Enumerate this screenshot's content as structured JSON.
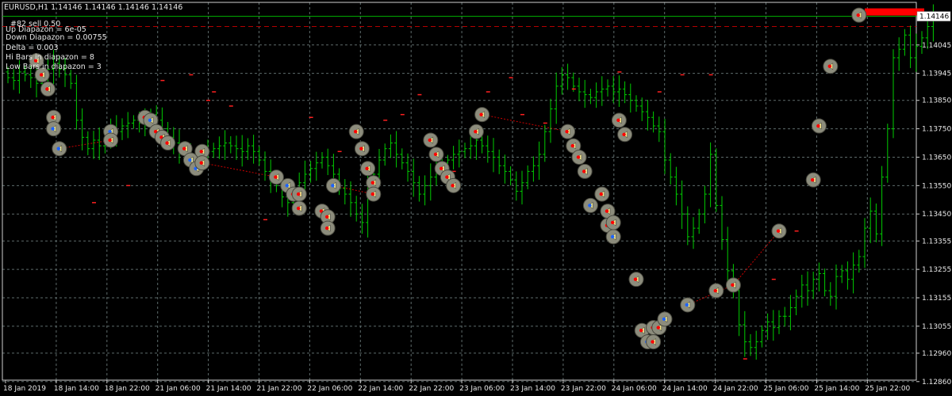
{
  "header": {
    "symbol_line": "EURUSD,H1  1.14146 1.14146 1.14146 1.14146",
    "info_lines": [
      "#82 sell 0.50",
      "Up Diapazon = 6e-05",
      "Down Diapazon = 0.00755",
      "Delta = 0.003",
      "Hi Bars in diapazon = 8",
      "Low Bars in diapazon = 3"
    ]
  },
  "colors": {
    "background": "#000000",
    "grid": "#5e6b6b",
    "bar": "#00cc00",
    "current_price_line": "#00b400",
    "order_line": "#b40000",
    "marker_up": "#ff0000",
    "marker_down": "#1e64ff",
    "marker_circle": "#8c8c7c",
    "trade_line": "#cc0000",
    "sell_box": "#ff0000"
  },
  "chart_data": {
    "type": "bar",
    "title": "",
    "xlabel": "",
    "ylabel": "",
    "symbol": "EURUSD",
    "timeframe": "H1",
    "ylim": [
      1.12865,
      1.14195
    ],
    "y_ticks": [
      "1.14045",
      "1.13945",
      "1.13850",
      "1.13750",
      "1.13650",
      "1.13550",
      "1.13450",
      "1.13355",
      "1.13255",
      "1.13155",
      "1.13055",
      "1.12960",
      "1.12860"
    ],
    "y_tick_values": [
      1.14045,
      1.13945,
      1.1385,
      1.1375,
      1.1365,
      1.1355,
      1.1345,
      1.13355,
      1.13255,
      1.13155,
      1.13055,
      1.1296,
      1.1286
    ],
    "x_ticks": [
      "18 Jan 2019",
      "18 Jan 14:00",
      "18 Jan 22:00",
      "21 Jan 06:00",
      "21 Jan 14:00",
      "21 Jan 22:00",
      "22 Jan 06:00",
      "22 Jan 14:00",
      "22 Jan 22:00",
      "23 Jan 06:00",
      "23 Jan 14:00",
      "23 Jan 22:00",
      "24 Jan 06:00",
      "24 Jan 14:00",
      "24 Jan 22:00",
      "25 Jan 06:00",
      "25 Jan 14:00",
      "25 Jan 22:00"
    ],
    "current_price": 1.14146,
    "current_price_label": "1.14146",
    "order_price": 1.1411,
    "closes": [
      1.1393,
      1.1392,
      1.1395,
      1.1394,
      1.1393,
      1.1391,
      1.1393,
      1.1396,
      1.1398,
      1.1396,
      1.1394,
      1.1391,
      1.1378,
      1.1372,
      1.1368,
      1.1371,
      1.1369,
      1.1372,
      1.1375,
      1.1374,
      1.1376,
      1.1377,
      1.1378,
      1.1377,
      1.1378,
      1.138,
      1.1378,
      1.1375,
      1.1372,
      1.137,
      1.1368,
      1.1366,
      1.1364,
      1.1365,
      1.1366,
      1.1367,
      1.1368,
      1.1369,
      1.137,
      1.1369,
      1.1368,
      1.1367,
      1.1369,
      1.1367,
      1.1364,
      1.136,
      1.1357,
      1.1355,
      1.1351,
      1.1349,
      1.1353,
      1.1356,
      1.1359,
      1.1361,
      1.1363,
      1.1365,
      1.1362,
      1.1359,
      1.1354,
      1.1352,
      1.1349,
      1.1345,
      1.1342,
      1.1355,
      1.1359,
      1.1364,
      1.1368,
      1.137,
      1.1366,
      1.1363,
      1.136,
      1.1356,
      1.1352,
      1.1355,
      1.1358,
      1.1361,
      1.1363,
      1.1364,
      1.1366,
      1.1367,
      1.1368,
      1.1369,
      1.1371,
      1.1369,
      1.1367,
      1.1365,
      1.1362,
      1.136,
      1.1357,
      1.1353,
      1.1356,
      1.136,
      1.1362,
      1.1366,
      1.1374,
      1.1382,
      1.139,
      1.1394,
      1.1393,
      1.139,
      1.1388,
      1.1387,
      1.1386,
      1.1388,
      1.1389,
      1.139,
      1.1388,
      1.1389,
      1.1387,
      1.1385,
      1.1383,
      1.1381,
      1.1379,
      1.1376,
      1.1374,
      1.1364,
      1.1358,
      1.1352,
      1.1345,
      1.1337,
      1.134,
      1.1345,
      1.1352,
      1.1366,
      1.1348,
      1.1336,
      1.1325,
      1.1318,
      1.1306,
      1.13,
      1.1298,
      1.13,
      1.1304,
      1.1307,
      1.1305,
      1.1309,
      1.1309,
      1.1312,
      1.1316,
      1.132,
      1.1318,
      1.1322,
      1.1324,
      1.1318,
      1.1316,
      1.1323,
      1.1325,
      1.1322,
      1.1327,
      1.133,
      1.134,
      1.1346,
      1.1338,
      1.1358,
      1.1375,
      1.14,
      1.1403,
      1.1408,
      1.14,
      1.1404,
      1.1407,
      1.1411,
      1.1414
    ],
    "bar_range_note": "OHLC bars, one per H1 period, 18 Jan 2019 to 25 Jan 2019",
    "trade_markers": [
      {
        "bar": 5,
        "price": 1.1399,
        "dir": "sell"
      },
      {
        "bar": 6,
        "price": 1.1394,
        "dir": "sell"
      },
      {
        "bar": 7,
        "price": 1.1389,
        "dir": "sell"
      },
      {
        "bar": 8,
        "price": 1.1379,
        "dir": "sell"
      },
      {
        "bar": 8,
        "price": 1.1375,
        "dir": "buy"
      },
      {
        "bar": 9,
        "price": 1.1368,
        "dir": "buy"
      },
      {
        "bar": 18,
        "price": 1.1374,
        "dir": "buy"
      },
      {
        "bar": 18,
        "price": 1.1371,
        "dir": "sell"
      },
      {
        "bar": 24,
        "price": 1.1379,
        "dir": "sell"
      },
      {
        "bar": 25,
        "price": 1.1378,
        "dir": "buy"
      },
      {
        "bar": 26,
        "price": 1.1374,
        "dir": "sell"
      },
      {
        "bar": 27,
        "price": 1.1372,
        "dir": "sell"
      },
      {
        "bar": 28,
        "price": 1.137,
        "dir": "sell"
      },
      {
        "bar": 31,
        "price": 1.1368,
        "dir": "sell"
      },
      {
        "bar": 32,
        "price": 1.1364,
        "dir": "buy"
      },
      {
        "bar": 33,
        "price": 1.1361,
        "dir": "buy"
      },
      {
        "bar": 34,
        "price": 1.1367,
        "dir": "sell"
      },
      {
        "bar": 34,
        "price": 1.1363,
        "dir": "sell"
      },
      {
        "bar": 47,
        "price": 1.1358,
        "dir": "sell"
      },
      {
        "bar": 49,
        "price": 1.1355,
        "dir": "buy"
      },
      {
        "bar": 50,
        "price": 1.1352,
        "dir": "sell"
      },
      {
        "bar": 51,
        "price": 1.1352,
        "dir": "sell"
      },
      {
        "bar": 51,
        "price": 1.1347,
        "dir": "sell"
      },
      {
        "bar": 55,
        "price": 1.1346,
        "dir": "sell"
      },
      {
        "bar": 56,
        "price": 1.1344,
        "dir": "sell"
      },
      {
        "bar": 56,
        "price": 1.134,
        "dir": "sell"
      },
      {
        "bar": 57,
        "price": 1.1355,
        "dir": "buy"
      },
      {
        "bar": 61,
        "price": 1.1374,
        "dir": "sell"
      },
      {
        "bar": 62,
        "price": 1.1368,
        "dir": "sell"
      },
      {
        "bar": 63,
        "price": 1.1361,
        "dir": "sell"
      },
      {
        "bar": 64,
        "price": 1.1356,
        "dir": "sell"
      },
      {
        "bar": 64,
        "price": 1.1352,
        "dir": "sell"
      },
      {
        "bar": 74,
        "price": 1.1371,
        "dir": "sell"
      },
      {
        "bar": 75,
        "price": 1.1366,
        "dir": "sell"
      },
      {
        "bar": 76,
        "price": 1.1361,
        "dir": "sell"
      },
      {
        "bar": 77,
        "price": 1.1358,
        "dir": "sell"
      },
      {
        "bar": 78,
        "price": 1.1355,
        "dir": "sell"
      },
      {
        "bar": 82,
        "price": 1.1374,
        "dir": "sell"
      },
      {
        "bar": 83,
        "price": 1.138,
        "dir": "sell"
      },
      {
        "bar": 98,
        "price": 1.1374,
        "dir": "sell"
      },
      {
        "bar": 99,
        "price": 1.1369,
        "dir": "sell"
      },
      {
        "bar": 100,
        "price": 1.1365,
        "dir": "sell"
      },
      {
        "bar": 101,
        "price": 1.136,
        "dir": "sell"
      },
      {
        "bar": 102,
        "price": 1.1348,
        "dir": "buy"
      },
      {
        "bar": 104,
        "price": 1.1352,
        "dir": "sell"
      },
      {
        "bar": 105,
        "price": 1.1346,
        "dir": "sell"
      },
      {
        "bar": 105,
        "price": 1.1341,
        "dir": "sell"
      },
      {
        "bar": 106,
        "price": 1.1337,
        "dir": "buy"
      },
      {
        "bar": 106,
        "price": 1.1342,
        "dir": "sell"
      },
      {
        "bar": 107,
        "price": 1.1378,
        "dir": "sell"
      },
      {
        "bar": 108,
        "price": 1.1373,
        "dir": "sell"
      },
      {
        "bar": 110,
        "price": 1.1322,
        "dir": "sell"
      },
      {
        "bar": 111,
        "price": 1.1304,
        "dir": "sell"
      },
      {
        "bar": 112,
        "price": 1.13,
        "dir": "buy"
      },
      {
        "bar": 113,
        "price": 1.1305,
        "dir": "sell"
      },
      {
        "bar": 113,
        "price": 1.13,
        "dir": "sell"
      },
      {
        "bar": 114,
        "price": 1.1305,
        "dir": "sell"
      },
      {
        "bar": 115,
        "price": 1.1308,
        "dir": "buy"
      },
      {
        "bar": 119,
        "price": 1.1313,
        "dir": "buy"
      },
      {
        "bar": 124,
        "price": 1.1318,
        "dir": "sell"
      },
      {
        "bar": 127,
        "price": 1.132,
        "dir": "sell"
      },
      {
        "bar": 135,
        "price": 1.1339,
        "dir": "sell"
      },
      {
        "bar": 141,
        "price": 1.1357,
        "dir": "sell"
      },
      {
        "bar": 142,
        "price": 1.1376,
        "dir": "sell"
      },
      {
        "bar": 144,
        "price": 1.1397,
        "dir": "sell"
      },
      {
        "bar": 149,
        "price": 1.1415,
        "dir": "sell"
      }
    ],
    "red_ticks": [
      {
        "bar": 15,
        "price": 1.1349
      },
      {
        "bar": 21,
        "price": 1.1355
      },
      {
        "bar": 27,
        "price": 1.1392
      },
      {
        "bar": 32,
        "price": 1.1394
      },
      {
        "bar": 35,
        "price": 1.1385
      },
      {
        "bar": 36,
        "price": 1.1388
      },
      {
        "bar": 39,
        "price": 1.1383
      },
      {
        "bar": 45,
        "price": 1.1343
      },
      {
        "bar": 53,
        "price": 1.1379
      },
      {
        "bar": 58,
        "price": 1.1367
      },
      {
        "bar": 66,
        "price": 1.1378
      },
      {
        "bar": 69,
        "price": 1.138
      },
      {
        "bar": 72,
        "price": 1.1387
      },
      {
        "bar": 78,
        "price": 1.136
      },
      {
        "bar": 84,
        "price": 1.1388
      },
      {
        "bar": 88,
        "price": 1.1393
      },
      {
        "bar": 90,
        "price": 1.138
      },
      {
        "bar": 94,
        "price": 1.1377
      },
      {
        "bar": 99,
        "price": 1.1389
      },
      {
        "bar": 107,
        "price": 1.1395
      },
      {
        "bar": 114,
        "price": 1.1388
      },
      {
        "bar": 118,
        "price": 1.1394
      },
      {
        "bar": 123,
        "price": 1.1394
      },
      {
        "bar": 129,
        "price": 1.1294
      },
      {
        "bar": 134,
        "price": 1.1322
      },
      {
        "bar": 138,
        "price": 1.1339
      }
    ],
    "trade_paths": [
      [
        [
          9,
          1.1368
        ],
        [
          18,
          1.1371
        ]
      ],
      [
        [
          34,
          1.1363
        ],
        [
          47,
          1.1358
        ]
      ],
      [
        [
          57,
          1.1355
        ],
        [
          64,
          1.1352
        ]
      ],
      [
        [
          83,
          1.138
        ],
        [
          98,
          1.1374
        ]
      ],
      [
        [
          119,
          1.1313
        ],
        [
          127,
          1.132
        ],
        [
          135,
          1.1339
        ]
      ]
    ],
    "sell_box_label": ""
  }
}
